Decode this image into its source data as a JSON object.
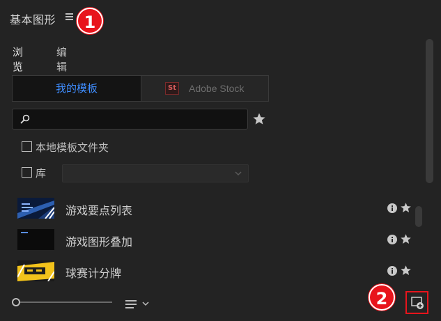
{
  "header": {
    "title": "基本图形",
    "callout_1": "1",
    "callout_2": "2"
  },
  "tabs": [
    {
      "label": "浏览",
      "active": true
    },
    {
      "label": "编辑",
      "active": false
    }
  ],
  "source_switch": {
    "mine_label": "我的模板",
    "stock_badge": "St",
    "stock_label": "Adobe Stock",
    "active": "mine"
  },
  "search": {
    "value": "",
    "placeholder": ""
  },
  "filters": {
    "local_folder_label": "本地模板文件夹",
    "library_label": "库",
    "library_value": ""
  },
  "templates": [
    {
      "label": "游戏要点列表"
    },
    {
      "label": "游戏图形叠加"
    },
    {
      "label": "球赛计分牌"
    }
  ],
  "colors": {
    "accent": "#3f8dff",
    "callout": "#e8141c",
    "background": "#232323"
  },
  "icons": [
    "menu-icon",
    "search-icon",
    "star-icon",
    "info-icon",
    "chevron-down-icon",
    "list-view-icon",
    "new-item-icon"
  ]
}
